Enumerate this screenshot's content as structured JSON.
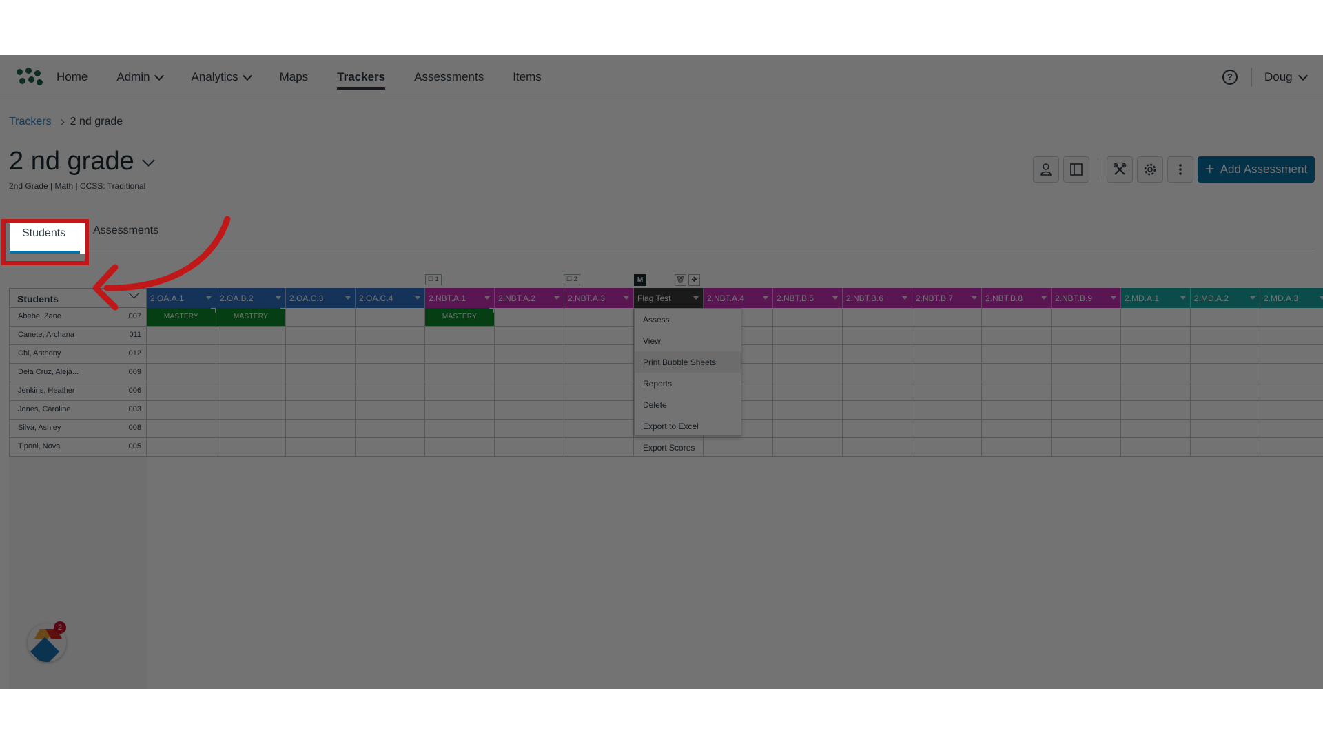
{
  "nav": {
    "items": [
      {
        "label": "Home",
        "dropdown": false,
        "active": false
      },
      {
        "label": "Admin",
        "dropdown": true,
        "active": false
      },
      {
        "label": "Analytics",
        "dropdown": true,
        "active": false
      },
      {
        "label": "Maps",
        "dropdown": false,
        "active": false
      },
      {
        "label": "Trackers",
        "dropdown": false,
        "active": true
      },
      {
        "label": "Assessments",
        "dropdown": false,
        "active": false
      },
      {
        "label": "Items",
        "dropdown": false,
        "active": false
      }
    ],
    "help_icon": "?",
    "user_name": "Doug"
  },
  "breadcrumb": {
    "parent": "Trackers",
    "current": "2 nd grade"
  },
  "page": {
    "title": "2 nd grade",
    "subtitle": "2nd Grade  |  Math  |  CCSS: Traditional",
    "add_button": "Add Assessment"
  },
  "toolbar_icons": [
    "person-icon",
    "panel-icon",
    "tools-icon",
    "gear-icon",
    "more-vertical-icon"
  ],
  "tabs": {
    "students": "Students",
    "assessments": "Assessments"
  },
  "grid": {
    "students_header": "Students",
    "students": [
      {
        "name": "Abebe, Zane",
        "id": "007"
      },
      {
        "name": "Canete, Archana",
        "id": "011"
      },
      {
        "name": "Chi, Anthony",
        "id": "012"
      },
      {
        "name": "Dela Cruz, Aleja...",
        "id": "009"
      },
      {
        "name": "Jenkins, Heather",
        "id": "006"
      },
      {
        "name": "Jones, Caroline",
        "id": "003"
      },
      {
        "name": "Silva, Ashley",
        "id": "008"
      },
      {
        "name": "Tiponi, Nova",
        "id": "005"
      }
    ],
    "columns": [
      {
        "label": "2.OA.A.1",
        "color": "#2f6fc4"
      },
      {
        "label": "2.OA.B.2",
        "color": "#2f6fc4"
      },
      {
        "label": "2.OA.C.3",
        "color": "#2f6fc4"
      },
      {
        "label": "2.OA.C.4",
        "color": "#2f6fc4"
      },
      {
        "label": "2.NBT.A.1",
        "color": "#c72fb8"
      },
      {
        "label": "2.NBT.A.2",
        "color": "#c72fb8"
      },
      {
        "label": "2.NBT.A.3",
        "color": "#c72fb8"
      },
      {
        "label": "Flag Test",
        "color": "#3a3a3a"
      },
      {
        "label": "2.NBT.A.4",
        "color": "#c72fb8"
      },
      {
        "label": "2.NBT.B.5",
        "color": "#c72fb8"
      },
      {
        "label": "2.NBT.B.6",
        "color": "#c72fb8"
      },
      {
        "label": "2.NBT.B.7",
        "color": "#c72fb8"
      },
      {
        "label": "2.NBT.B.8",
        "color": "#c72fb8"
      },
      {
        "label": "2.NBT.B.9",
        "color": "#c72fb8"
      },
      {
        "label": "2.MD.A.1",
        "color": "#1aa7a3"
      },
      {
        "label": "2.MD.A.2",
        "color": "#1aa7a3"
      },
      {
        "label": "2.MD.A.3",
        "color": "#1aa7a3"
      }
    ],
    "mastery_label": "MASTERY",
    "mastery_cells": [
      [
        0,
        0
      ],
      [
        0,
        1
      ],
      [
        0,
        4
      ]
    ],
    "group_badges": [
      "1",
      "2"
    ],
    "flag_badge": "M"
  },
  "menu": {
    "items": [
      "Assess",
      "View",
      "Print Bubble Sheets",
      "Reports",
      "Delete",
      "Export to Excel",
      "Export Scores"
    ],
    "highlighted": "Print Bubble Sheets"
  },
  "helper": {
    "badge_count": "2"
  }
}
